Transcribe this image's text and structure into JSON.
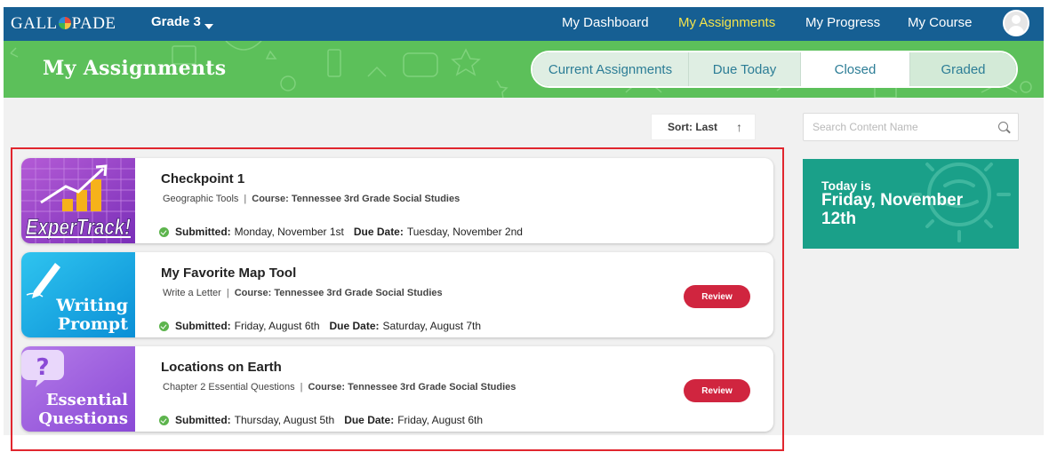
{
  "header": {
    "logo_text_left": "GALL",
    "logo_text_right": "PADE",
    "grade_label": "Grade 3",
    "nav": [
      {
        "label": "My Dashboard",
        "active": false
      },
      {
        "label": "My Assignments",
        "active": true
      },
      {
        "label": "My Progress",
        "active": false
      },
      {
        "label": "My Course",
        "active": false
      }
    ]
  },
  "banner": {
    "title": "My Assignments",
    "tabs": [
      {
        "label": "Current Assignments",
        "selected": false
      },
      {
        "label": "Due Today",
        "selected": false
      },
      {
        "label": "Closed",
        "selected": true
      },
      {
        "label": "Graded",
        "selected": false
      }
    ]
  },
  "toolbar": {
    "sort_label": "Sort: Last",
    "sort_icon": "arrow-up-icon",
    "search_placeholder": "Search Content Name",
    "search_value": ""
  },
  "assignments": [
    {
      "thumb_text": "ExperTrack!",
      "thumb_type": "expertrack",
      "title": "Checkpoint 1",
      "category": "Geographic Tools",
      "course_label": "Course:",
      "course": "Tennessee 3rd Grade Social Studies",
      "submitted_label": "Submitted:",
      "submitted": "Monday, November 1st",
      "due_label": "Due Date:",
      "due": "Tuesday, November 2nd",
      "review_label": ""
    },
    {
      "thumb_text_line1": "Writing",
      "thumb_text_line2": "Prompt",
      "thumb_type": "writing",
      "title": "My Favorite Map Tool",
      "category": "Write a Letter",
      "course_label": "Course:",
      "course": "Tennessee 3rd Grade Social Studies",
      "submitted_label": "Submitted:",
      "submitted": "Friday, August 6th",
      "due_label": "Due Date:",
      "due": "Saturday, August 7th",
      "review_label": "Review"
    },
    {
      "thumb_text_line1": "Essential",
      "thumb_text_line2": "Questions",
      "thumb_type": "essential",
      "title": "Locations on Earth",
      "category": "Chapter 2 Essential Questions",
      "course_label": "Course:",
      "course": "Tennessee 3rd Grade Social Studies",
      "submitted_label": "Submitted:",
      "submitted": "Thursday, August 5th",
      "due_label": "Due Date:",
      "due": "Friday, August 6th",
      "review_label": "Review"
    }
  ],
  "today_widget": {
    "label": "Today is",
    "date": "Friday, November 12th"
  },
  "colors": {
    "header_blue": "#165f93",
    "banner_green": "#5cc05a",
    "active_nav": "#f4e34b",
    "review_red": "#d0253f",
    "today_teal": "#1aa089",
    "highlight_red": "#e1262e"
  }
}
